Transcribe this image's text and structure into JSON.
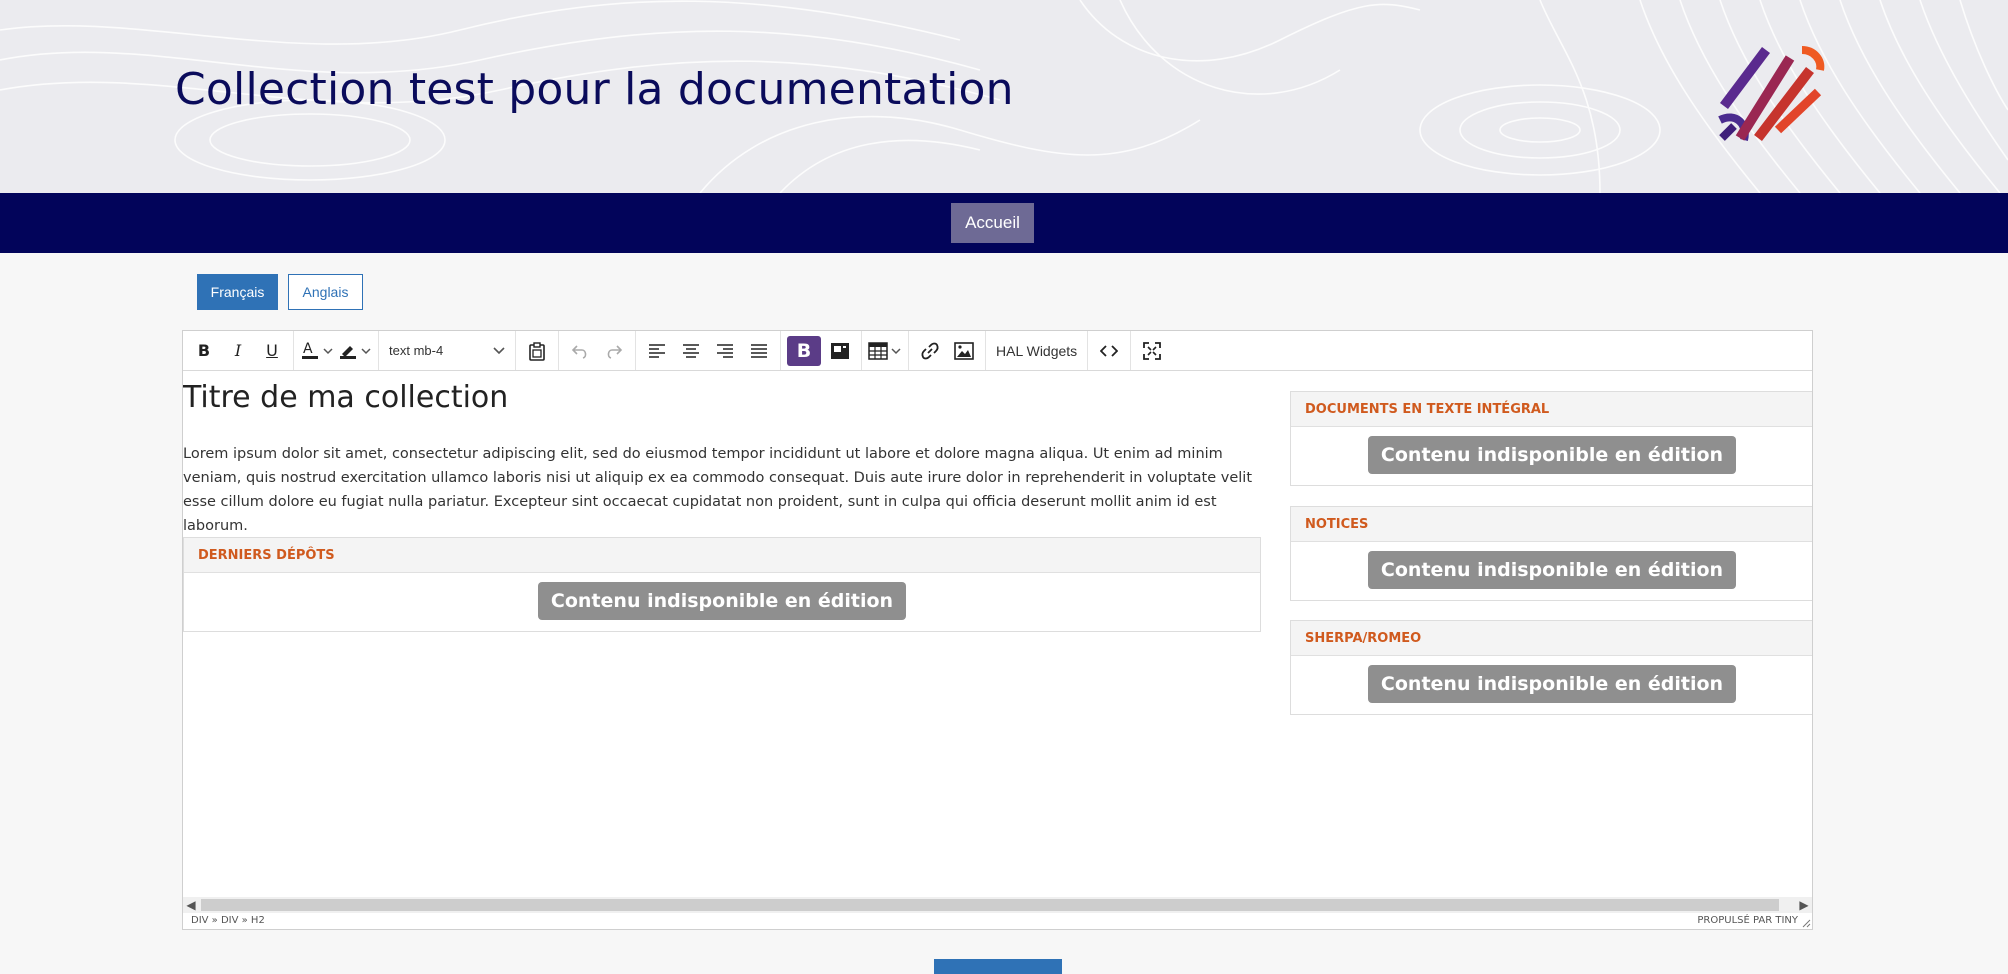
{
  "header": {
    "title": "Collection test pour la documentation",
    "logo_icon": "hal-arcs-logo"
  },
  "nav": {
    "home": "Accueil"
  },
  "languages": {
    "fr": "Français",
    "en": "Anglais"
  },
  "toolbar": {
    "bold": "B",
    "italic": "I",
    "underline": "U",
    "block_format": "text mb-4",
    "active_b": "B",
    "hal_widgets": "HAL Widgets"
  },
  "content": {
    "title": "Titre de ma collection",
    "paragraph": "Lorem ipsum dolor sit amet, consectetur adipiscing elit, sed do eiusmod tempor incididunt ut labore et dolore magna aliqua. Ut enim ad minim veniam, quis nostrud exercitation ullamco laboris nisi ut aliquip ex ea commodo consequat. Duis aute irure dolor in reprehenderit in voluptate velit esse cillum dolore eu fugiat nulla pariatur. Excepteur sint occaecat cupidatat non proident, sunt in culpa qui officia deserunt mollit anim id est laborum.",
    "unavailable": "Contenu indisponible en édition",
    "cards": {
      "derniers": "DERNIERS DÉPÔTS",
      "documents": "DOCUMENTS EN TEXTE INTÉGRAL",
      "notices": "NOTICES",
      "sherpa": "SHERPA/ROMEO"
    }
  },
  "statusbar": {
    "path": "DIV » DIV » H2",
    "brand": "PROPULSÉ PAR TINY"
  },
  "colors": {
    "navy": "#02045a",
    "accent_orange": "#d05a1e",
    "button_blue": "#2f72b6",
    "active_purple": "#5b3c87"
  }
}
